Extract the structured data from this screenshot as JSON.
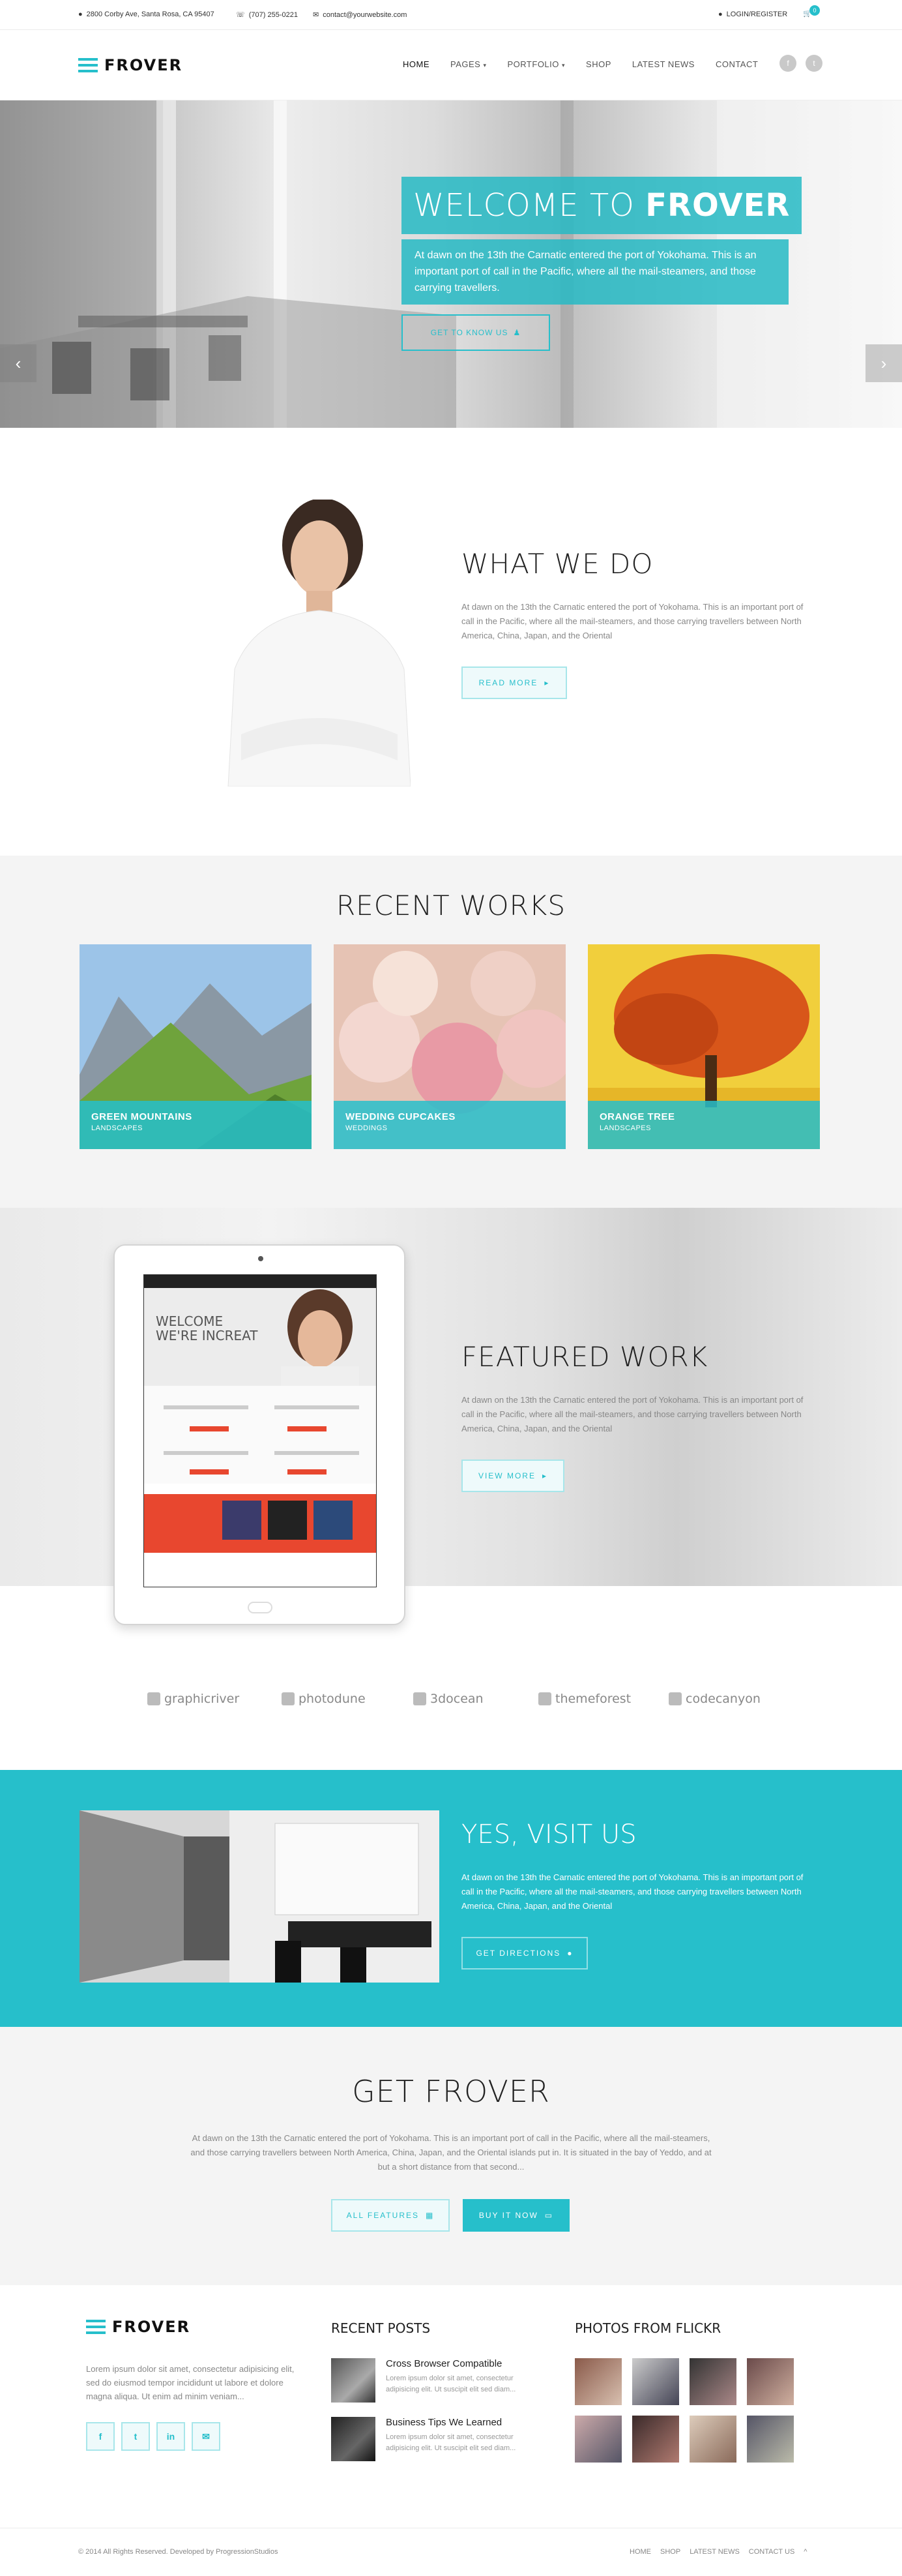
{
  "topbar": {
    "address": "2800 Corby Ave, Santa Rosa, CA 95407",
    "phone": "(707) 255-0221",
    "email": "contact@yourwebsite.com",
    "login": "LOGIN/REGISTER",
    "cart_count": "0"
  },
  "header": {
    "logo": "FROVER",
    "nav": [
      "HOME",
      "PAGES",
      "PORTFOLIO",
      "SHOP",
      "LATEST NEWS",
      "CONTACT"
    ],
    "social": [
      "f",
      "t"
    ]
  },
  "hero": {
    "title_light": "WELCOME TO ",
    "title_bold": "FROVER",
    "text": "At dawn on the 13th the Carnatic entered the port of Yokohama. This is an important port of call in the Pacific, where all the mail-steamers, and those carrying travellers.",
    "button": "GET TO KNOW US",
    "prev": "‹",
    "next": "›"
  },
  "what_we_do": {
    "title": "WHAT WE DO",
    "text": "At dawn on the 13th the Carnatic entered the port of Yokohama. This is an important port of call in the Pacific, where all the mail-steamers, and those carrying travellers between North America, China, Japan, and the Oriental",
    "button": "READ MORE"
  },
  "recent_works": {
    "title": "RECENT WORKS",
    "items": [
      {
        "title": "GREEN MOUNTAINS",
        "category": "LANDSCAPES"
      },
      {
        "title": "WEDDING CUPCAKES",
        "category": "WEDDINGS"
      },
      {
        "title": "ORANGE TREE",
        "category": "LANDSCAPES"
      }
    ]
  },
  "featured": {
    "title": "FEATURED WORK",
    "text": "At dawn on the 13th the Carnatic entered the port of Yokohama. This is an important port of call in the Pacific, where all the mail-steamers, and those carrying travellers between North America, China, Japan, and the Oriental",
    "button": "VIEW MORE",
    "tablet_headline_1": "WELCOME",
    "tablet_headline_2": "WE'RE INCREAT"
  },
  "partners": [
    "graphicriver",
    "photodune",
    "3docean",
    "themeforest",
    "codecanyon"
  ],
  "visit": {
    "title": "YES, VISIT US",
    "text": "At dawn on the 13th the Carnatic entered the port of Yokohama. This is an important port of call in the Pacific, where all the mail-steamers, and those carrying travellers between North America, China, Japan, and the Oriental",
    "button": "GET DIRECTIONS"
  },
  "get": {
    "title": "GET FROVER",
    "text": "At dawn on the 13th the Carnatic entered the port of Yokohama. This is an important port of call in the Pacific, where all the mail-steamers, and those carrying travellers between North America, China, Japan, and the Oriental islands put in. It is situated in the bay of Yeddo, and at but a short distance from that second...",
    "btn_features": "ALL FEATURES",
    "btn_buy": "BUY IT NOW"
  },
  "footer": {
    "logo": "FROVER",
    "about": "Lorem ipsum dolor sit amet, consectetur adipisicing elit, sed do eiusmod tempor incididunt ut labore et dolore magna aliqua. Ut enim ad minim veniam...",
    "social": [
      "f",
      "t",
      "in",
      "✉"
    ],
    "recent_posts_title": "RECENT POSTS",
    "posts": [
      {
        "title": "Cross Browser Compatible",
        "excerpt": "Lorem ipsum dolor sit amet, consectetur adipisicing elit. Ut suscipit elit sed diam..."
      },
      {
        "title": "Business Tips We Learned",
        "excerpt": "Lorem ipsum dolor sit amet, consectetur adipisicing elit. Ut suscipit elit sed diam..."
      }
    ],
    "flickr_title": "PHOTOS FROM FLICKR",
    "copyright": "© 2014 All Rights Reserved. Developed by ProgressionStudios",
    "bottom_nav": [
      "HOME",
      "SHOP",
      "LATEST NEWS",
      "CONTACT US"
    ]
  },
  "colors": {
    "accent": "#26bfcb",
    "dark": "#222222"
  }
}
